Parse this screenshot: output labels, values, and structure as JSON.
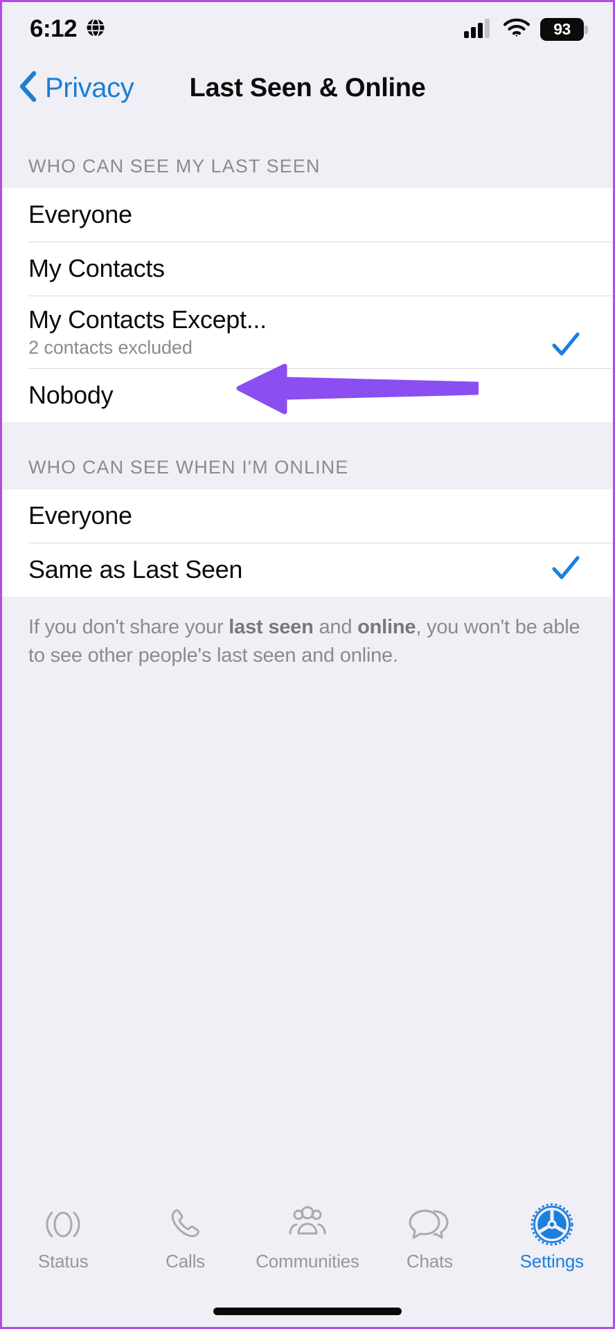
{
  "status_bar": {
    "time": "6:12",
    "location_icon": "globe-icon",
    "cellular_icon": "signal-bars-icon",
    "wifi_icon": "wifi-icon",
    "battery_level": "93"
  },
  "nav": {
    "back_label": "Privacy",
    "back_icon": "chevron-left-icon",
    "title": "Last Seen & Online"
  },
  "sections": [
    {
      "header": "WHO CAN SEE MY LAST SEEN",
      "rows": [
        {
          "title": "Everyone",
          "subtitle": "",
          "selected": false
        },
        {
          "title": "My Contacts",
          "subtitle": "",
          "selected": false
        },
        {
          "title": "My Contacts Except...",
          "subtitle": "2 contacts excluded",
          "selected": true
        },
        {
          "title": "Nobody",
          "subtitle": "",
          "selected": false
        }
      ]
    },
    {
      "header": "WHO CAN SEE WHEN I'M ONLINE",
      "rows": [
        {
          "title": "Everyone",
          "subtitle": "",
          "selected": false
        },
        {
          "title": "Same as Last Seen",
          "subtitle": "",
          "selected": true
        }
      ]
    }
  ],
  "footnote": {
    "part1": "If you don't share your ",
    "bold1": "last seen",
    "part2": " and ",
    "bold2": "online",
    "part3": ", you won't be able to see other people's last seen and online."
  },
  "tabs": [
    {
      "label": "Status",
      "icon": "status-ring-icon",
      "active": false
    },
    {
      "label": "Calls",
      "icon": "phone-icon",
      "active": false
    },
    {
      "label": "Communities",
      "icon": "communities-icon",
      "active": false
    },
    {
      "label": "Chats",
      "icon": "chat-bubbles-icon",
      "active": false
    },
    {
      "label": "Settings",
      "icon": "gear-icon",
      "active": true
    }
  ],
  "annotation": {
    "type": "arrow-left",
    "color": "#8b4ef0"
  },
  "colors": {
    "accent_blue": "#1a7fd4",
    "check_blue": "#1b7fe0",
    "annotation_purple": "#8b4ef0",
    "frame_purple": "#b44ae8",
    "background": "#f0eff5",
    "card": "#ffffff",
    "muted_text": "#8a8a92"
  }
}
